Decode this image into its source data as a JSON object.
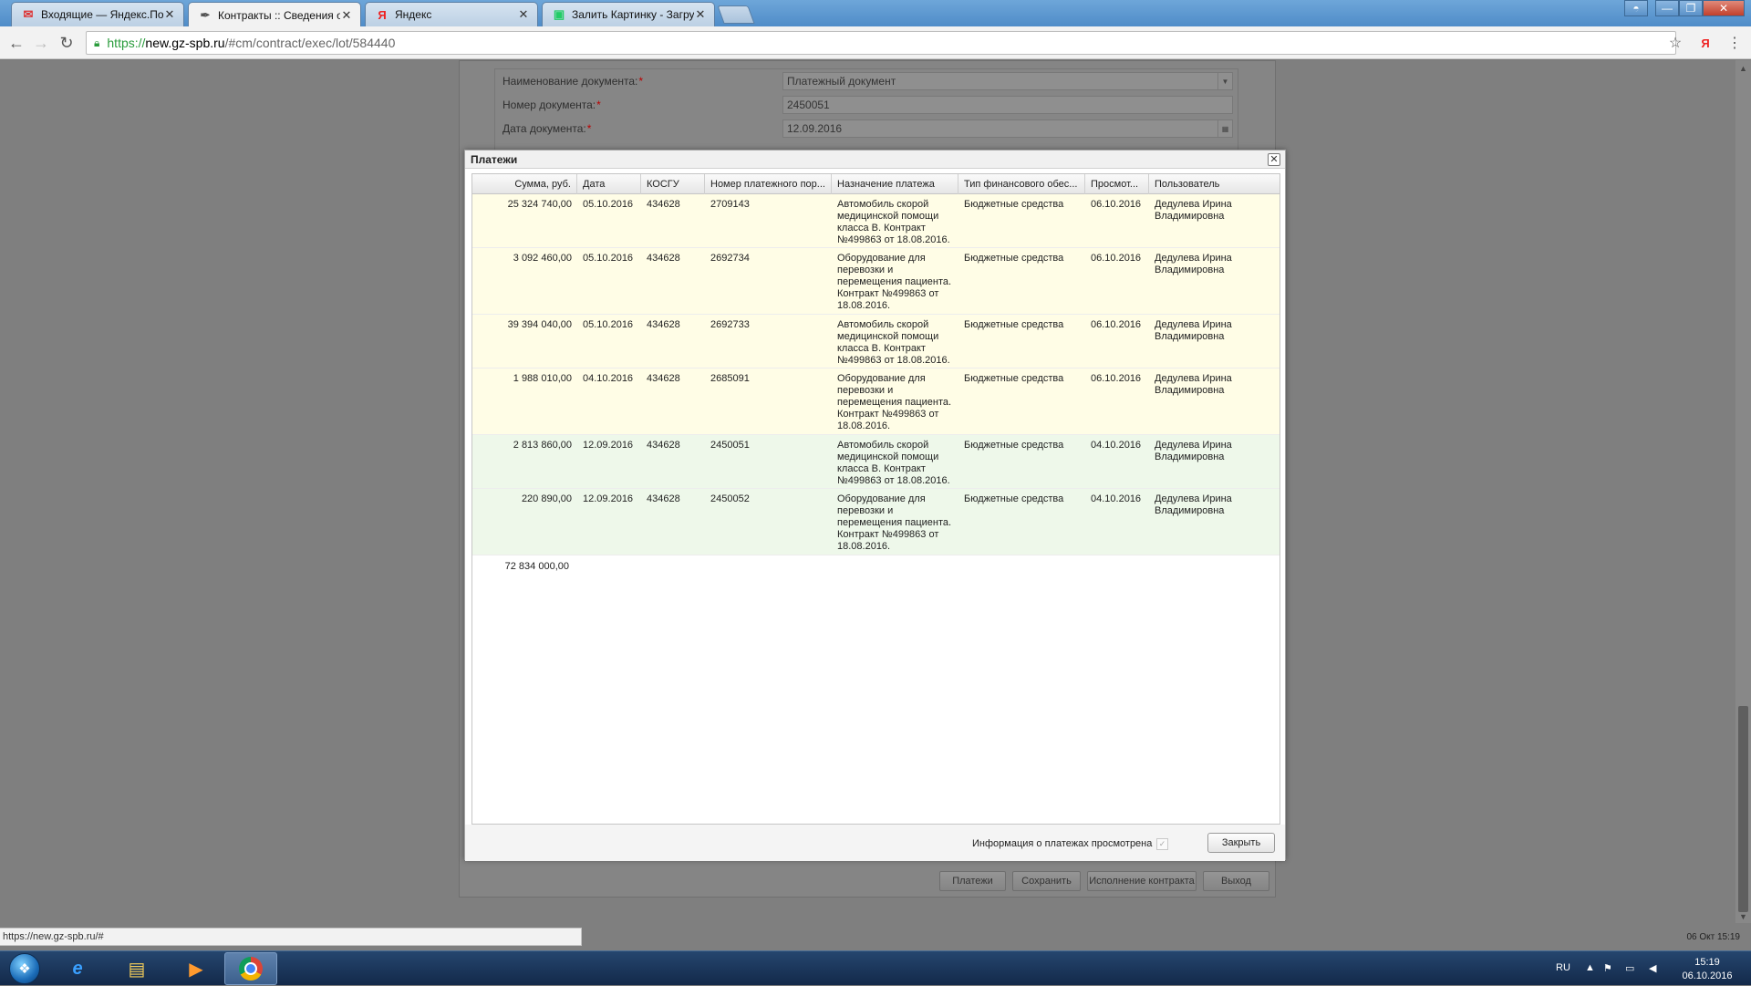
{
  "browser": {
    "tabs": [
      {
        "title": "Входящие — Яндекс.По",
        "icon": "mail-icon"
      },
      {
        "title": "Контракты :: Сведения о",
        "icon": "gz-logo-icon",
        "active": true
      },
      {
        "title": "Яндекс",
        "icon": "yandex-icon"
      },
      {
        "title": "Залить Картинку - Загру",
        "icon": "image-icon"
      }
    ],
    "url": {
      "protocol": "https://",
      "host": "new.gz-spb.ru",
      "path": "/#cm/contract/exec/lot/584440"
    },
    "yandex_ext": "Я"
  },
  "form": {
    "fields": [
      {
        "label": "Наименование документа:",
        "value": "Платежный документ"
      },
      {
        "label": "Номер документа:",
        "value": "2450051"
      },
      {
        "label": "Дата документа:",
        "value": "12.09.2016"
      }
    ],
    "required_mark": "*",
    "buttons": {
      "payments": "Платежи",
      "save": "Сохранить",
      "execution": "Исполнение контракта",
      "exit": "Выход"
    }
  },
  "modal": {
    "title": "Платежи",
    "columns": [
      "Сумма, руб.",
      "Дата",
      "КОСГУ",
      "Номер платежного пор...",
      "Назначение платежа",
      "Тип финансового обес...",
      "Просмот...",
      "Пользователь"
    ],
    "rows": [
      {
        "sum": "25 324 740,00",
        "date": "05.10.2016",
        "kosgu": "434628",
        "number": "2709143",
        "purpose": "Автомобиль скорой медицинской помощи класса B. Контракт №499863 от 18.08.2016.",
        "fin_type": "Бюджетные средства",
        "viewed": "06.10.2016",
        "user": "Дедулева Ирина Владимировна",
        "status": "viewed"
      },
      {
        "sum": "3 092 460,00",
        "date": "05.10.2016",
        "kosgu": "434628",
        "number": "2692734",
        "purpose": "Оборудование для перевозки и перемещения пациента. Контракт №499863 от 18.08.2016.",
        "fin_type": "Бюджетные средства",
        "viewed": "06.10.2016",
        "user": "Дедулева Ирина Владимировна",
        "status": "viewed"
      },
      {
        "sum": "39 394 040,00",
        "date": "05.10.2016",
        "kosgu": "434628",
        "number": "2692733",
        "purpose": "Автомобиль скорой медицинской помощи класса B. Контракт №499863 от 18.08.2016.",
        "fin_type": "Бюджетные средства",
        "viewed": "06.10.2016",
        "user": "Дедулева Ирина Владимировна",
        "status": "viewed"
      },
      {
        "sum": "1 988 010,00",
        "date": "04.10.2016",
        "kosgu": "434628",
        "number": "2685091",
        "purpose": "Оборудование для перевозки и перемещения пациента. Контракт №499863 от 18.08.2016.",
        "fin_type": "Бюджетные средства",
        "viewed": "06.10.2016",
        "user": "Дедулева Ирина Владимировна",
        "status": "viewed"
      },
      {
        "sum": "2 813 860,00",
        "date": "12.09.2016",
        "kosgu": "434628",
        "number": "2450051",
        "purpose": "Автомобиль скорой медицинской помощи класса B. Контракт №499863 от 18.08.2016.",
        "fin_type": "Бюджетные средства",
        "viewed": "04.10.2016",
        "user": "Дедулева Ирина Владимировна",
        "status": "done"
      },
      {
        "sum": "220 890,00",
        "date": "12.09.2016",
        "kosgu": "434628",
        "number": "2450052",
        "purpose": "Оборудование для перевозки и перемещения пациента. Контракт №499863 от 18.08.2016.",
        "fin_type": "Бюджетные средства",
        "viewed": "04.10.2016",
        "user": "Дедулева Ирина Владимировна",
        "status": "done"
      }
    ],
    "total": "72 834 000,00",
    "viewed_checkbox_label": "Информация о платежах просмотрена",
    "close_button": "Закрыть"
  },
  "statusbar": {
    "url": "https://new.gz-spb.ru/#",
    "page_date": "06 Окт 15:19"
  },
  "taskbar": {
    "apps": [
      "internet-explorer-icon",
      "file-explorer-icon",
      "media-player-icon",
      "chrome-icon"
    ],
    "lang": "RU",
    "time": "15:19",
    "date": "06.10.2016"
  },
  "colors": {
    "row_viewed": "#fffde6",
    "row_done": "#eef8ea",
    "accent_green": "#2a9c3c"
  }
}
